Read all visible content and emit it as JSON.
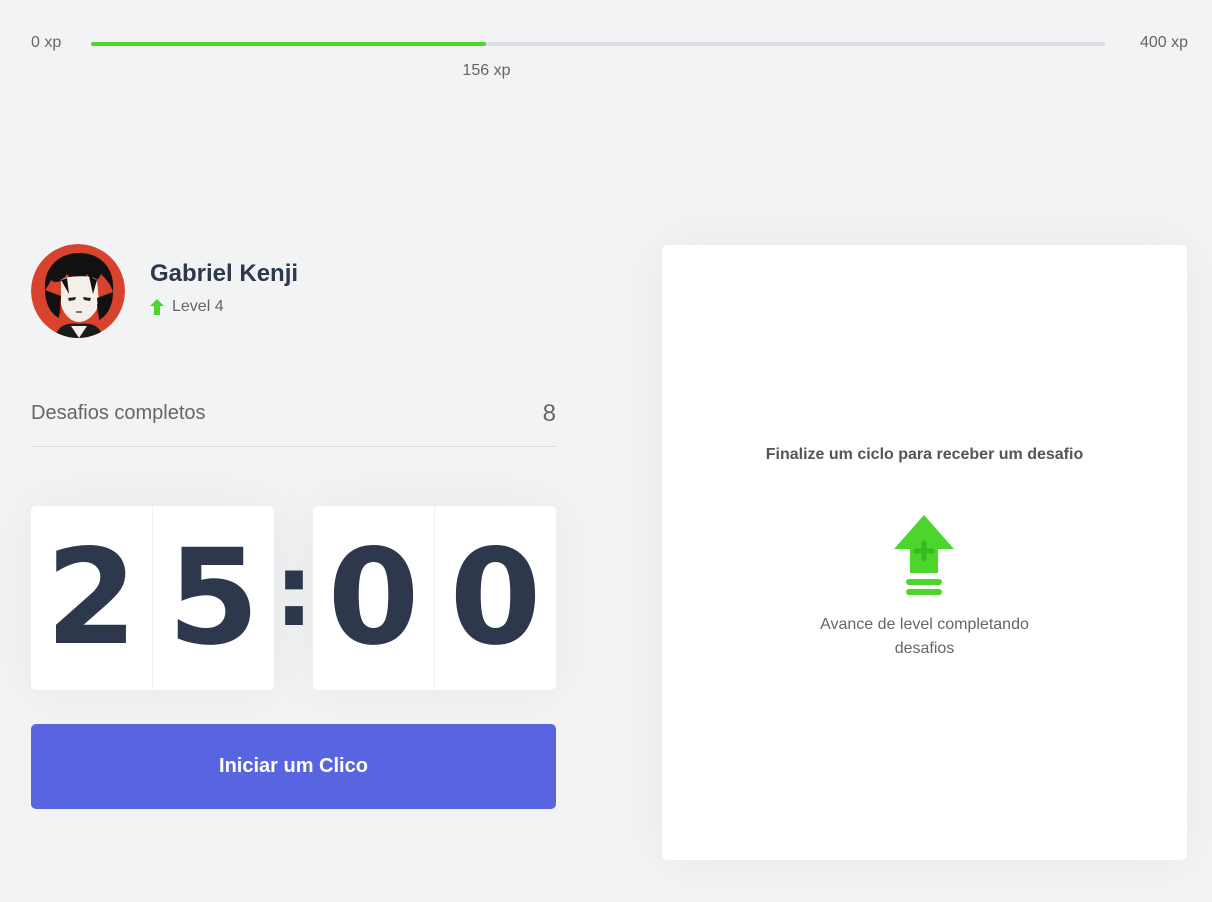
{
  "xp_bar": {
    "min_label": "0 xp",
    "max_label": "400 xp",
    "current_label": "156 xp",
    "current": 156,
    "max": 400
  },
  "profile": {
    "name": "Gabriel Kenji",
    "level_label": "Level 4",
    "level_icon": "level-up-arrow-icon"
  },
  "completed": {
    "label": "Desafios completos",
    "count": "8"
  },
  "countdown": {
    "minute_left": "2",
    "minute_right": "5",
    "separator": ":",
    "second_left": "0",
    "second_right": "0"
  },
  "start_button": {
    "label": "Iniciar um Clico"
  },
  "challenge_box": {
    "title": "Finalize um ciclo para receber um desafio",
    "icon": "level-up-icon",
    "description": "Avance de level completando desafios"
  },
  "colors": {
    "accent_green": "#4cd62b",
    "button_blue": "#5965e0",
    "text_dark": "#2e384d",
    "background": "#f2f3f5"
  }
}
